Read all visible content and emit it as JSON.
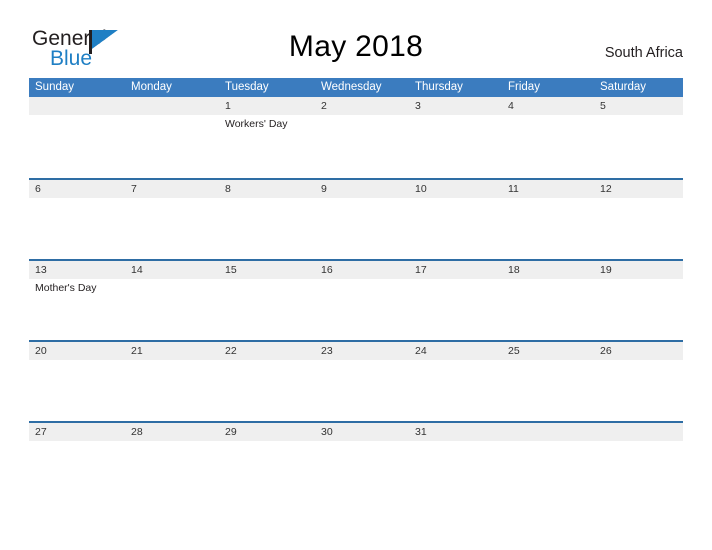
{
  "brand": {
    "name_part1": "General",
    "name_part2": "Blue",
    "flag_icon": "blue-triangle-flag-icon",
    "accent_color": "#1f7fc4"
  },
  "header": {
    "title": "May 2018",
    "country": "South Africa"
  },
  "theme": {
    "header_blue": "#3b7cbf",
    "row_line_blue": "#2e6da4",
    "band_gray": "#efefef",
    "text_dark": "#231f20"
  },
  "calendar": {
    "weekdays": [
      "Sunday",
      "Monday",
      "Tuesday",
      "Wednesday",
      "Thursday",
      "Friday",
      "Saturday"
    ],
    "weeks": [
      {
        "days": [
          {
            "date": "",
            "event": ""
          },
          {
            "date": "",
            "event": ""
          },
          {
            "date": "1",
            "event": "Workers' Day"
          },
          {
            "date": "2",
            "event": ""
          },
          {
            "date": "3",
            "event": ""
          },
          {
            "date": "4",
            "event": ""
          },
          {
            "date": "5",
            "event": ""
          }
        ]
      },
      {
        "days": [
          {
            "date": "6",
            "event": ""
          },
          {
            "date": "7",
            "event": ""
          },
          {
            "date": "8",
            "event": ""
          },
          {
            "date": "9",
            "event": ""
          },
          {
            "date": "10",
            "event": ""
          },
          {
            "date": "11",
            "event": ""
          },
          {
            "date": "12",
            "event": ""
          }
        ]
      },
      {
        "days": [
          {
            "date": "13",
            "event": "Mother's Day"
          },
          {
            "date": "14",
            "event": ""
          },
          {
            "date": "15",
            "event": ""
          },
          {
            "date": "16",
            "event": ""
          },
          {
            "date": "17",
            "event": ""
          },
          {
            "date": "18",
            "event": ""
          },
          {
            "date": "19",
            "event": ""
          }
        ]
      },
      {
        "days": [
          {
            "date": "20",
            "event": ""
          },
          {
            "date": "21",
            "event": ""
          },
          {
            "date": "22",
            "event": ""
          },
          {
            "date": "23",
            "event": ""
          },
          {
            "date": "24",
            "event": ""
          },
          {
            "date": "25",
            "event": ""
          },
          {
            "date": "26",
            "event": ""
          }
        ]
      },
      {
        "days": [
          {
            "date": "27",
            "event": ""
          },
          {
            "date": "28",
            "event": ""
          },
          {
            "date": "29",
            "event": ""
          },
          {
            "date": "30",
            "event": ""
          },
          {
            "date": "31",
            "event": ""
          },
          {
            "date": "",
            "event": ""
          },
          {
            "date": "",
            "event": ""
          }
        ]
      }
    ]
  }
}
